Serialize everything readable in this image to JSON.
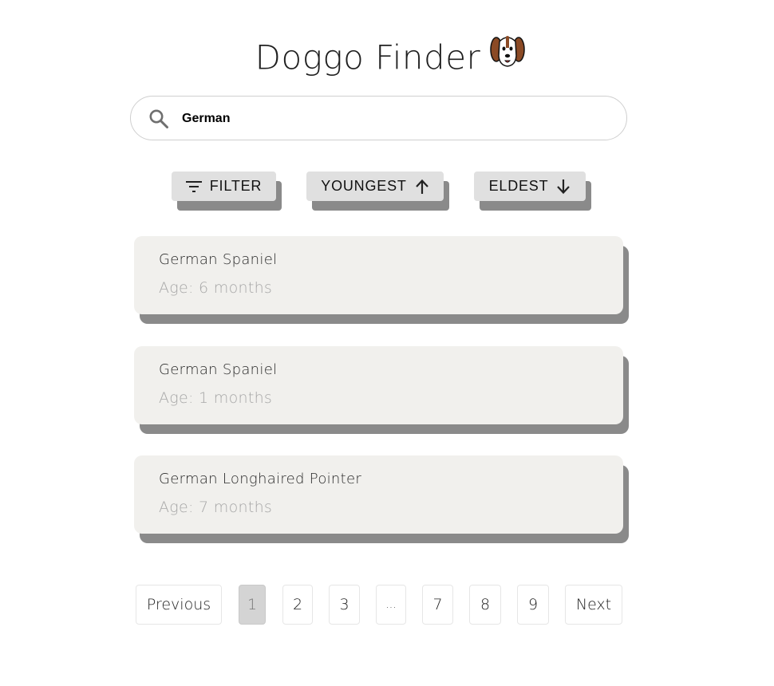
{
  "header": {
    "title": "Doggo Finder",
    "logo_icon": "dog-face-icon"
  },
  "search": {
    "value": "German",
    "placeholder": "",
    "icon": "search-icon"
  },
  "sort_buttons": {
    "filter_label": "FILTER",
    "youngest_label": "YOUNGEST",
    "eldest_label": "ELDEST"
  },
  "results": [
    {
      "breed": "German Spaniel",
      "age": "Age: 6 months"
    },
    {
      "breed": "German Spaniel",
      "age": "Age: 1 months"
    },
    {
      "breed": "German Longhaired Pointer",
      "age": "Age: 7 months"
    }
  ],
  "pagination": {
    "previous_label": "Previous",
    "next_label": "Next",
    "pages": [
      "1",
      "2",
      "3",
      "...",
      "7",
      "8",
      "9"
    ],
    "current_page": "1"
  },
  "colors": {
    "card_background": "#f1f0ed",
    "button_background": "#e0e0e0",
    "shadow": "#8a8a8a",
    "active_page": "#d4d4d4"
  }
}
